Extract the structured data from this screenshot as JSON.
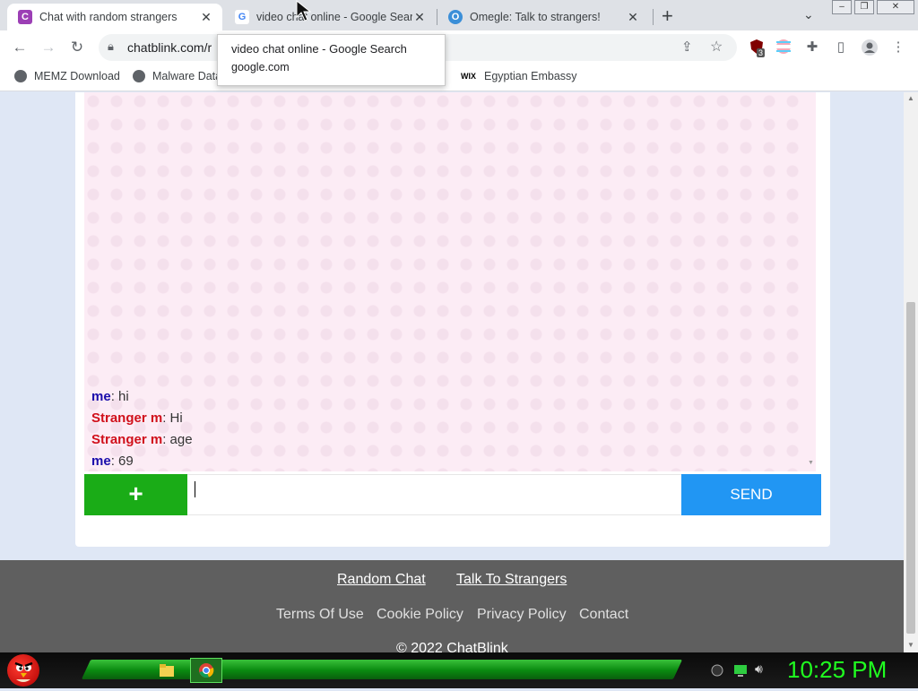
{
  "browser": {
    "tabs": [
      {
        "title": "Chat with random strangers",
        "favicon_letter": "C",
        "favicon_color": "#9c3fb5"
      },
      {
        "title": "video chat online - Google Search",
        "favicon_letter": "G",
        "favicon_color": "#4285f4"
      },
      {
        "title": "Omegle: Talk to strangers!",
        "favicon_letter": "O",
        "favicon_color": "#3b8fd8"
      }
    ],
    "new_tab_label": "+",
    "url": "chatblink.com/r",
    "bookmarks": [
      {
        "label": "MEMZ Download"
      },
      {
        "label": "Malware Data"
      },
      {
        "label": "Egyptian Embassy",
        "prefix": "WIX"
      }
    ],
    "tooltip": {
      "title": "video chat online - Google Search",
      "domain": "google.com"
    },
    "extension_badge": "3"
  },
  "chat": {
    "messages": [
      {
        "sender": "me",
        "role": "me",
        "text": ": hi"
      },
      {
        "sender": "Stranger m",
        "role": "stranger",
        "text": ": Hi"
      },
      {
        "sender": "Stranger m",
        "role": "stranger",
        "text": ": age"
      },
      {
        "sender": "me",
        "role": "me",
        "text": ": 69"
      }
    ],
    "plus_label": "+",
    "input_value": "",
    "send_label": "SEND"
  },
  "footer": {
    "links_top": [
      "Random Chat",
      "Talk To Strangers"
    ],
    "links_bottom": [
      "Terms Of Use",
      "Cookie Policy",
      "Privacy Policy",
      "Contact"
    ],
    "copyright": "© 2022 ChatBlink"
  },
  "taskbar": {
    "clock": "10:25 PM"
  },
  "colors": {
    "send_button": "#2196f3",
    "plus_button": "#1aac17",
    "me_name": "#1a0dab",
    "stranger_name": "#d0101b",
    "chat_background": "#fcecf5",
    "footer_background": "#5f5f5f",
    "clock": "#20ff20"
  }
}
